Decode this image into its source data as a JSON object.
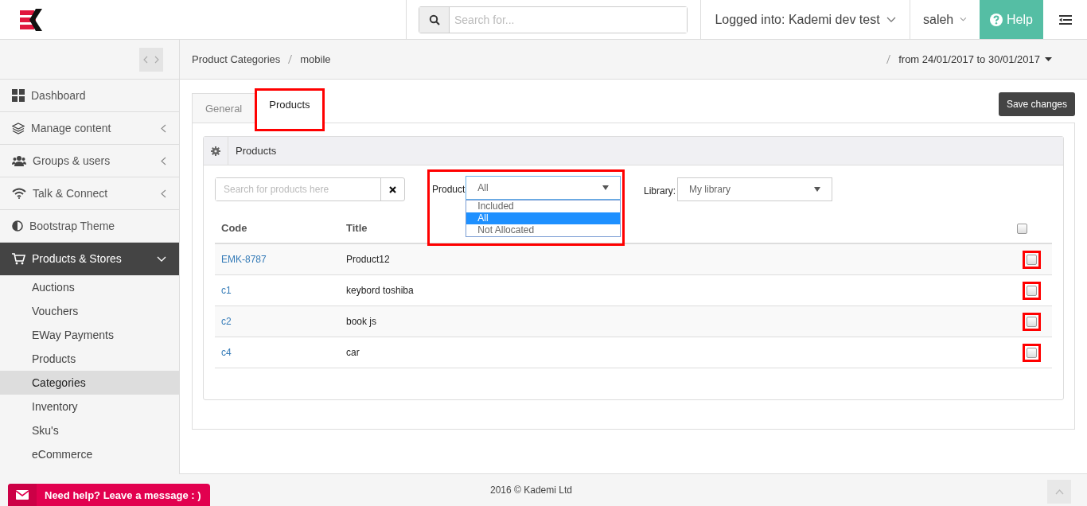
{
  "header": {
    "search_placeholder": "Search for...",
    "account": "Logged into: Kademi dev test",
    "user": "saleh",
    "help": "Help"
  },
  "sidebar": {
    "items": [
      {
        "label": "Dashboard",
        "selected": false
      },
      {
        "label": "Manage content",
        "selected": false,
        "expanded": false
      },
      {
        "label": "Groups & users",
        "selected": false,
        "expanded": false
      },
      {
        "label": "Talk & Connect",
        "selected": false,
        "expanded": false
      },
      {
        "label": "Bootstrap Theme",
        "selected": false
      },
      {
        "label": "Products & Stores",
        "selected": true,
        "expanded": true,
        "children": [
          {
            "label": "Auctions",
            "selected": false
          },
          {
            "label": "Vouchers",
            "selected": false
          },
          {
            "label": "EWay Payments",
            "selected": false
          },
          {
            "label": "Products",
            "selected": false
          },
          {
            "label": "Categories",
            "selected": true
          },
          {
            "label": "Inventory",
            "selected": false
          },
          {
            "label": "Sku's",
            "selected": false
          },
          {
            "label": "eCommerce",
            "selected": false
          }
        ]
      }
    ]
  },
  "breadcrumb": [
    "Product Categories",
    "mobile"
  ],
  "date_range": "from 24/01/2017 to 30/01/2017",
  "tabs": [
    {
      "label": "General",
      "selected": false,
      "highlighted": false
    },
    {
      "label": "Products",
      "selected": true,
      "highlighted": true
    }
  ],
  "save_button": "Save changes",
  "panel": {
    "title": "Products",
    "search_placeholder": "Search for products here",
    "product_filter": {
      "label": "Product",
      "value": "All",
      "open": true,
      "highlighted": true,
      "options": [
        {
          "label": "Included",
          "selected": false
        },
        {
          "label": "All",
          "selected": true
        },
        {
          "label": "Not Allocated",
          "selected": false
        }
      ]
    },
    "library_filter": {
      "label": "Library:",
      "value": "My library"
    },
    "table": {
      "columns": [
        "Code",
        "Title"
      ],
      "header_checked": false,
      "rows": [
        {
          "code": "EMK-8787",
          "title": "Product12",
          "checked": false,
          "highlighted": true
        },
        {
          "code": "c1",
          "title": "keybord toshiba",
          "checked": false,
          "highlighted": true
        },
        {
          "code": "c2",
          "title": "book js",
          "checked": false,
          "highlighted": true
        },
        {
          "code": "c4",
          "title": "car",
          "checked": false,
          "highlighted": true
        }
      ]
    }
  },
  "footer": "2016 © Kademi Ltd",
  "chat_button": "Need help? Leave a message : )"
}
